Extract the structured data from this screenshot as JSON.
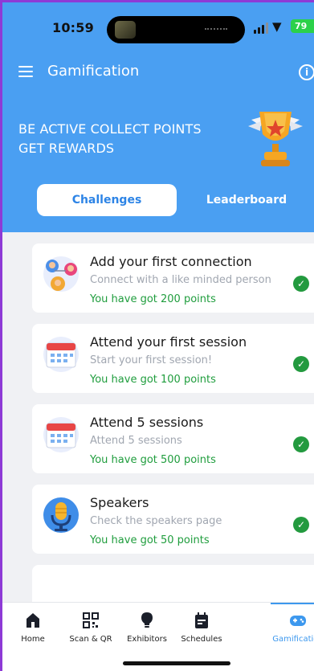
{
  "status_bar": {
    "time": "10:59",
    "battery": "79"
  },
  "app_bar": {
    "title": "Gamification"
  },
  "banner": {
    "line1": "BE ACTIVE COLLECT POINTS",
    "line2": "GET REWARDS"
  },
  "tabs": [
    {
      "label": "Challenges",
      "active": true
    },
    {
      "label": "Leaderboard",
      "active": false
    }
  ],
  "challenges": [
    {
      "title": "Add your first connection",
      "subtitle": "Connect with a like minded person",
      "points": "You have got 200 points",
      "icon": "people-icon"
    },
    {
      "title": "Attend your first session",
      "subtitle": "Start your first session!",
      "points": "You have got 100 points",
      "icon": "calendar-icon"
    },
    {
      "title": "Attend 5 sessions",
      "subtitle": "Attend 5 sessions",
      "points": "You have got 500 points",
      "icon": "calendar-icon"
    },
    {
      "title": "Speakers",
      "subtitle": "Check the speakers page",
      "points": "You have got 50 points",
      "icon": "microphone-icon"
    }
  ],
  "nav": [
    {
      "label": "Home",
      "icon": "home-icon"
    },
    {
      "label": "Scan & QR",
      "icon": "qr-code-icon"
    },
    {
      "label": "Exhibitors",
      "icon": "lightbulb-icon"
    },
    {
      "label": "Schedules",
      "icon": "schedule-icon"
    },
    {
      "label": "Gamification",
      "icon": "gamepad-icon",
      "active": true
    }
  ],
  "colors": {
    "primary": "#4a9ff2",
    "success": "#239a3f",
    "points_text": "#1f9d3d",
    "background": "#f0f1f4"
  }
}
